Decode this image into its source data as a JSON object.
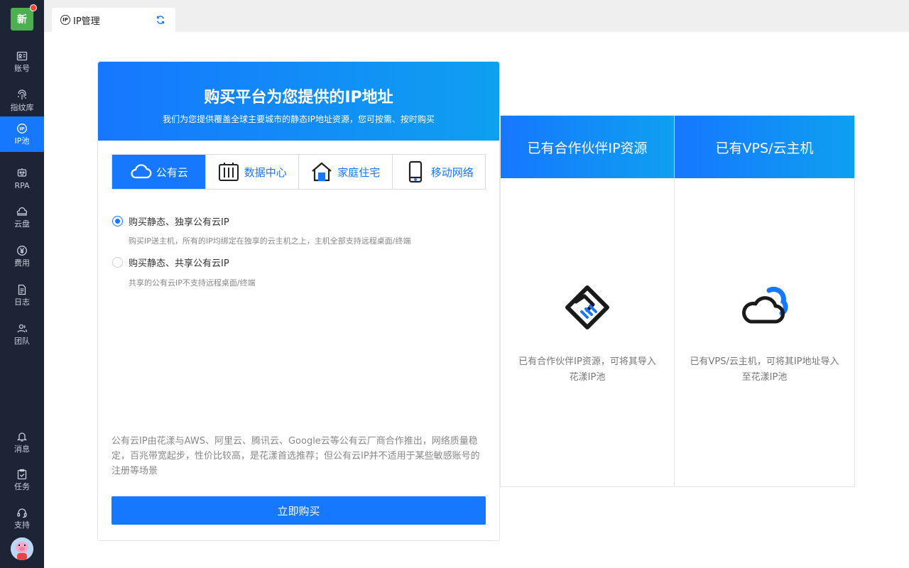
{
  "app": {
    "logo_text": "新",
    "accent_color": "#1677ff",
    "sidebar_bg": "#1d2436"
  },
  "sidebar": {
    "items": [
      {
        "label": "账号",
        "icon": "account-card-icon"
      },
      {
        "label": "指纹库",
        "icon": "fingerprint-icon"
      },
      {
        "label": "IP池",
        "icon": "ip-icon",
        "active": true
      },
      {
        "label": "RPA",
        "icon": "robot-icon"
      },
      {
        "label": "云盘",
        "icon": "cloud-drive-icon"
      },
      {
        "label": "费用",
        "icon": "yen-icon"
      },
      {
        "label": "日志",
        "icon": "log-document-icon"
      },
      {
        "label": "团队",
        "icon": "team-icon"
      }
    ],
    "bottom_items": [
      {
        "label": "消息",
        "icon": "bell-icon"
      },
      {
        "label": "任务",
        "icon": "task-clipboard-icon"
      },
      {
        "label": "支持",
        "icon": "headset-icon"
      }
    ]
  },
  "tabs": [
    {
      "label": "IP管理",
      "icon": "ip-icon",
      "action_icon": "refresh-icon"
    }
  ],
  "main_card": {
    "title": "购买平台为您提供的IP地址",
    "subtitle": "我们为您提供覆盖全球主要城市的静态IP地址资源，您可按需、按时购买",
    "types": [
      {
        "label": "公有云",
        "icon": "cloud-icon",
        "active": true
      },
      {
        "label": "数据中心",
        "icon": "server-rack-icon"
      },
      {
        "label": "家庭住宅",
        "icon": "house-icon"
      },
      {
        "label": "移动网络",
        "icon": "mobile-phone-icon"
      }
    ],
    "options": [
      {
        "label": "购买静态、独享公有云IP",
        "desc": "购买IP送主机，所有的IP均绑定在独享的云主机之上，主机全部支持远程桌面/终端",
        "selected": true
      },
      {
        "label": "购买静态、共享公有云IP",
        "desc": "共享的公有云IP不支持远程桌面/终端",
        "selected": false
      }
    ],
    "description": "公有云IP由花漾与AWS、阿里云、腾讯云、Google云等公有云厂商合作推出，网络质量稳定，百兆带宽起步，性价比较高，是花漾首选推荐；但公有云IP并不适用于某些敏感账号的注册等场景",
    "buy_button": "立即购买"
  },
  "side_cards": [
    {
      "title": "已有合作伙伴IP资源",
      "icon": "handshake-icon",
      "text": "已有合作伙伴IP资源，可将其导入花漾IP池"
    },
    {
      "title": "已有VPS/云主机",
      "icon": "cloud-icon",
      "text": "已有VPS/云主机，可将其IP地址导入至花漾IP池"
    }
  ]
}
